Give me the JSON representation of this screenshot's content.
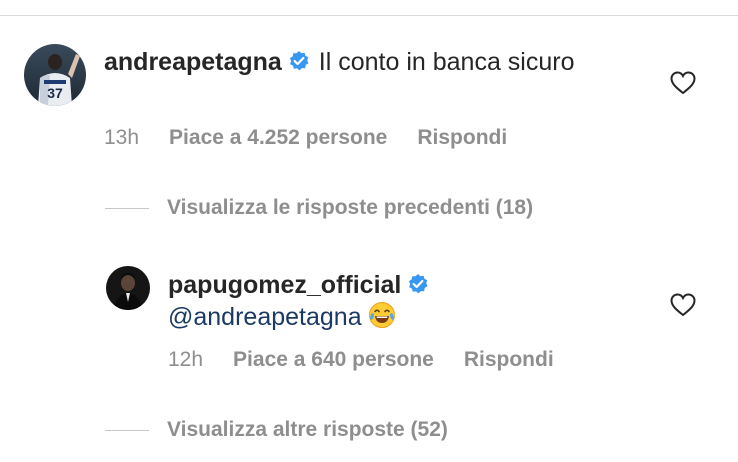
{
  "comment": {
    "username": "andreapetagna",
    "text": "Il conto in banca sicuro",
    "jersey_number": "37",
    "time": "13h",
    "likes": "Piace a 4.252 persone",
    "reply_label": "Rispondi",
    "verified": true
  },
  "view_previous": {
    "label": "Visualizza le risposte precedenti (18)"
  },
  "reply": {
    "username": "papugomez_official",
    "mention": "@andreapetagna",
    "emoji": "face-with-tears-of-joy",
    "time": "12h",
    "likes": "Piace a 640 persone",
    "reply_label": "Rispondi",
    "verified": true
  },
  "view_more": {
    "label": "Visualizza altre risposte (52)"
  },
  "colors": {
    "text": "#262626",
    "muted": "#8e8e8e",
    "verified": "#3897f0",
    "mention": "#1b3a63"
  }
}
